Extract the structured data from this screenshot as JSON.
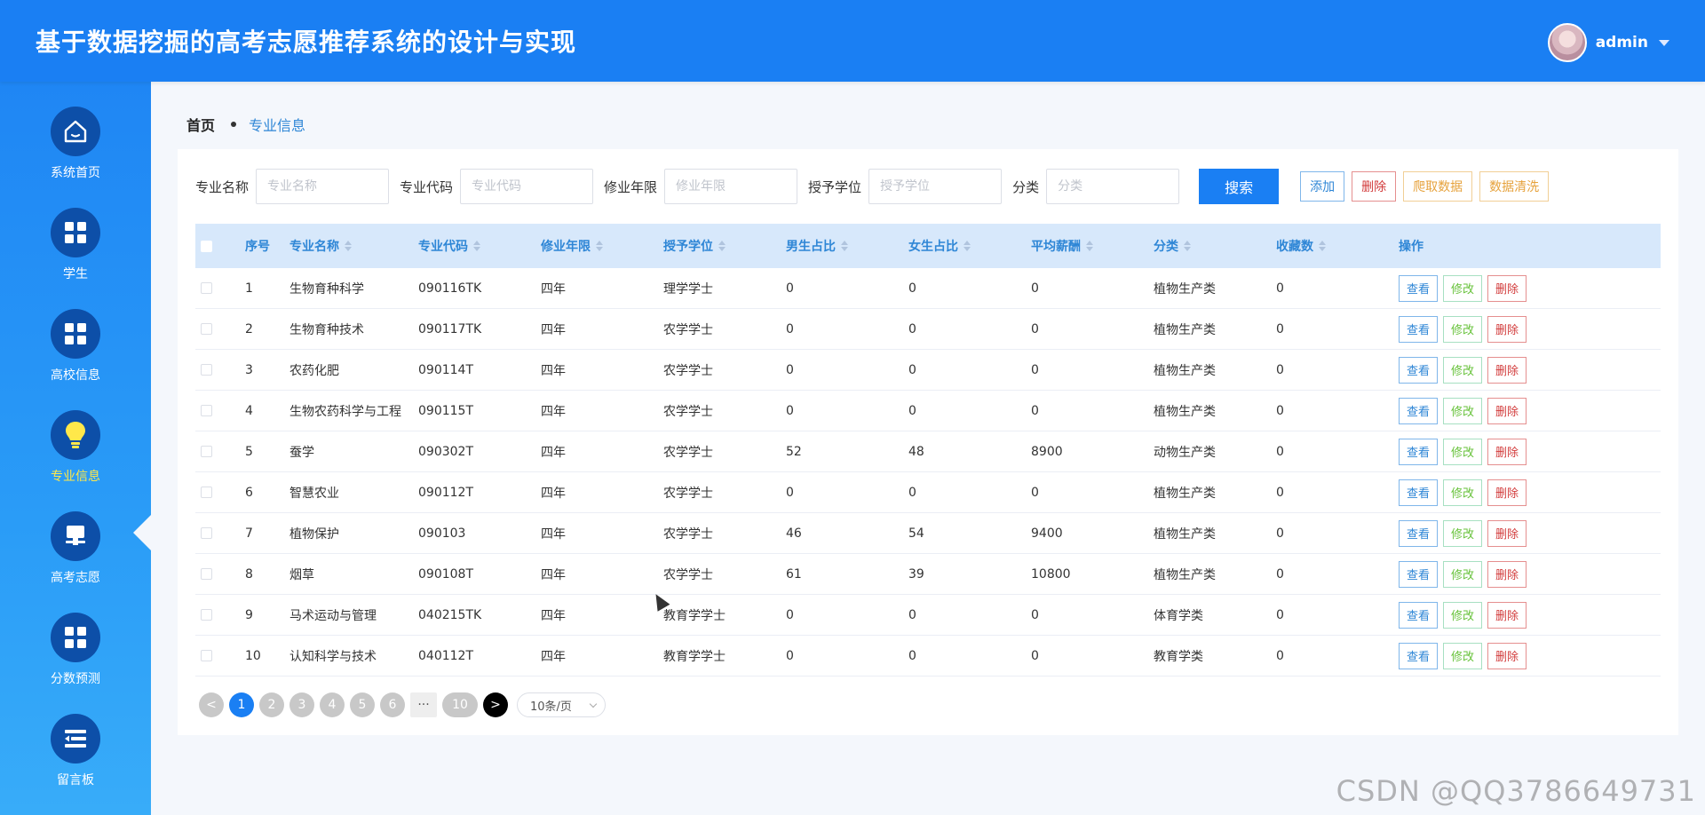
{
  "header": {
    "title": "基于数据挖掘的高考志愿推荐系统的设计与实现",
    "username": "admin"
  },
  "sidebar": {
    "items": [
      {
        "label": "系统首页",
        "icon": "home-icon"
      },
      {
        "label": "学生",
        "icon": "grid-icon"
      },
      {
        "label": "高校信息",
        "icon": "grid-icon"
      },
      {
        "label": "专业信息",
        "icon": "lightbulb-icon",
        "active": true
      },
      {
        "label": "高考志愿",
        "icon": "stamp-icon"
      },
      {
        "label": "分数预测",
        "icon": "grid-icon"
      },
      {
        "label": "留言板",
        "icon": "list-icon"
      }
    ]
  },
  "breadcrumb": {
    "home": "首页",
    "current": "专业信息"
  },
  "search": {
    "fields": [
      {
        "label": "专业名称",
        "placeholder": "专业名称"
      },
      {
        "label": "专业代码",
        "placeholder": "专业代码"
      },
      {
        "label": "修业年限",
        "placeholder": "修业年限"
      },
      {
        "label": "授予学位",
        "placeholder": "授予学位"
      },
      {
        "label": "分类",
        "placeholder": "分类"
      }
    ],
    "search_label": "搜索",
    "add_label": "添加",
    "delete_label": "删除",
    "crawl_label": "爬取数据",
    "clean_label": "数据清洗"
  },
  "table": {
    "headers": [
      "序号",
      "专业名称",
      "专业代码",
      "修业年限",
      "授予学位",
      "男生占比",
      "女生占比",
      "平均薪酬",
      "分类",
      "收藏数",
      "操作"
    ],
    "rows": [
      {
        "idx": "1",
        "name": "生物育种科学",
        "code": "090116TK",
        "years": "四年",
        "degree": "理学学士",
        "male": "0",
        "female": "0",
        "salary": "0",
        "cat": "植物生产类",
        "fav": "0"
      },
      {
        "idx": "2",
        "name": "生物育种技术",
        "code": "090117TK",
        "years": "四年",
        "degree": "农学学士",
        "male": "0",
        "female": "0",
        "salary": "0",
        "cat": "植物生产类",
        "fav": "0"
      },
      {
        "idx": "3",
        "name": "农药化肥",
        "code": "090114T",
        "years": "四年",
        "degree": "农学学士",
        "male": "0",
        "female": "0",
        "salary": "0",
        "cat": "植物生产类",
        "fav": "0"
      },
      {
        "idx": "4",
        "name": "生物农药科学与工程",
        "code": "090115T",
        "years": "四年",
        "degree": "农学学士",
        "male": "0",
        "female": "0",
        "salary": "0",
        "cat": "植物生产类",
        "fav": "0"
      },
      {
        "idx": "5",
        "name": "蚕学",
        "code": "090302T",
        "years": "四年",
        "degree": "农学学士",
        "male": "52",
        "female": "48",
        "salary": "8900",
        "cat": "动物生产类",
        "fav": "0"
      },
      {
        "idx": "6",
        "name": "智慧农业",
        "code": "090112T",
        "years": "四年",
        "degree": "农学学士",
        "male": "0",
        "female": "0",
        "salary": "0",
        "cat": "植物生产类",
        "fav": "0"
      },
      {
        "idx": "7",
        "name": "植物保护",
        "code": "090103",
        "years": "四年",
        "degree": "农学学士",
        "male": "46",
        "female": "54",
        "salary": "9400",
        "cat": "植物生产类",
        "fav": "0"
      },
      {
        "idx": "8",
        "name": "烟草",
        "code": "090108T",
        "years": "四年",
        "degree": "农学学士",
        "male": "61",
        "female": "39",
        "salary": "10800",
        "cat": "植物生产类",
        "fav": "0"
      },
      {
        "idx": "9",
        "name": "马术运动与管理",
        "code": "040215TK",
        "years": "四年",
        "degree": "教育学学士",
        "male": "0",
        "female": "0",
        "salary": "0",
        "cat": "体育学类",
        "fav": "0"
      },
      {
        "idx": "10",
        "name": "认知科学与技术",
        "code": "040112T",
        "years": "四年",
        "degree": "教育学学士",
        "male": "0",
        "female": "0",
        "salary": "0",
        "cat": "教育学类",
        "fav": "0"
      }
    ],
    "op_view": "查看",
    "op_edit": "修改",
    "op_delete": "删除"
  },
  "pagination": {
    "prev": "<",
    "pages": [
      "1",
      "2",
      "3",
      "4",
      "5",
      "6"
    ],
    "ellipsis": "···",
    "last": "10",
    "next": ">",
    "page_size": "10条/页"
  },
  "watermark": "CSDN @QQ3786649731",
  "colors": {
    "primary": "#1a7ff3",
    "header": "#1a7ff3",
    "sidebar_active": "#ffe84a",
    "danger": "#d23b3b",
    "warning": "#e6a23c",
    "success": "#67c23a"
  }
}
